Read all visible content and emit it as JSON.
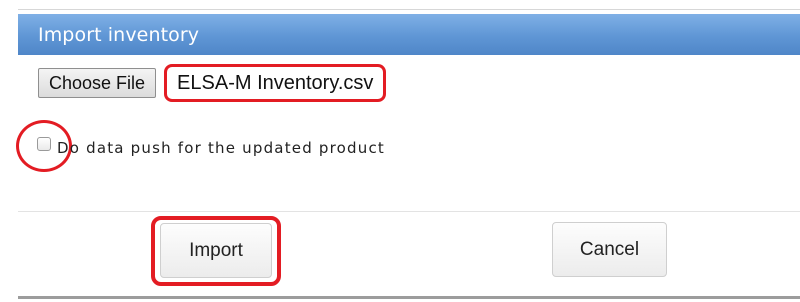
{
  "dialog": {
    "title": "Import inventory",
    "title_bar_color": "#5f96d5",
    "choose_file_label": "Choose File",
    "selected_file_name": "ELSA-M Inventory.csv",
    "data_push_checkbox": {
      "label": "Do data push for the updated product",
      "checked": false
    },
    "import_button_label": "Import",
    "cancel_button_label": "Cancel",
    "highlight_color": "#e31c23"
  }
}
